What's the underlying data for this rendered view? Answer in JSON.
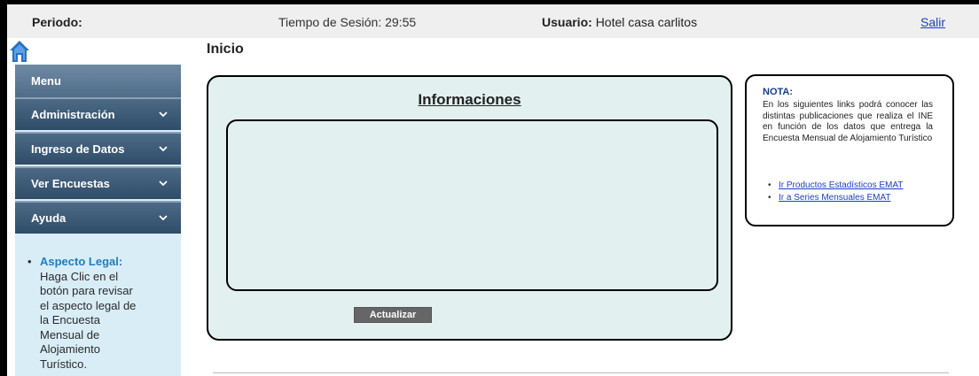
{
  "topbar": {
    "periodo_label": "Periodo:",
    "session_text": "Tiempo de Sesión: 29:55",
    "usuario_label": "Usuario:",
    "usuario_value": "Hotel casa carlitos",
    "salir_label": "Salir"
  },
  "page": {
    "title": "Inicio"
  },
  "sidebar": {
    "menu_label": "Menu",
    "items": [
      {
        "label": "Administración"
      },
      {
        "label": "Ingreso de Datos"
      },
      {
        "label": "Ver Encuestas"
      },
      {
        "label": "Ayuda"
      }
    ],
    "legal": {
      "title": "Aspecto Legal:",
      "lines": [
        "Haga Clic en el",
        "botón para revisar",
        "el aspecto legal de",
        "la Encuesta",
        "Mensual de",
        "Alojamiento",
        "Turístico."
      ]
    }
  },
  "info": {
    "title": "Informaciones",
    "button_label": "Actualizar"
  },
  "nota": {
    "title": "NOTA:",
    "text": "En los siguientes links podrá conocer las distintas publicaciones que realiza el INE en función de los datos que entrega la Encuesta Mensual de Alojamiento Turístico",
    "links": [
      {
        "label": "Ir Productos Estadísticos EMAT"
      },
      {
        "label": "Ir a Series Mensuales EMAT"
      }
    ]
  },
  "colors": {
    "sidebar_bg": "#d9edf7",
    "menu_dark": "#2f4c68",
    "panel_bg": "#e3f0f0",
    "link": "#1a3ec7",
    "home_icon": "#2a6fc0"
  }
}
